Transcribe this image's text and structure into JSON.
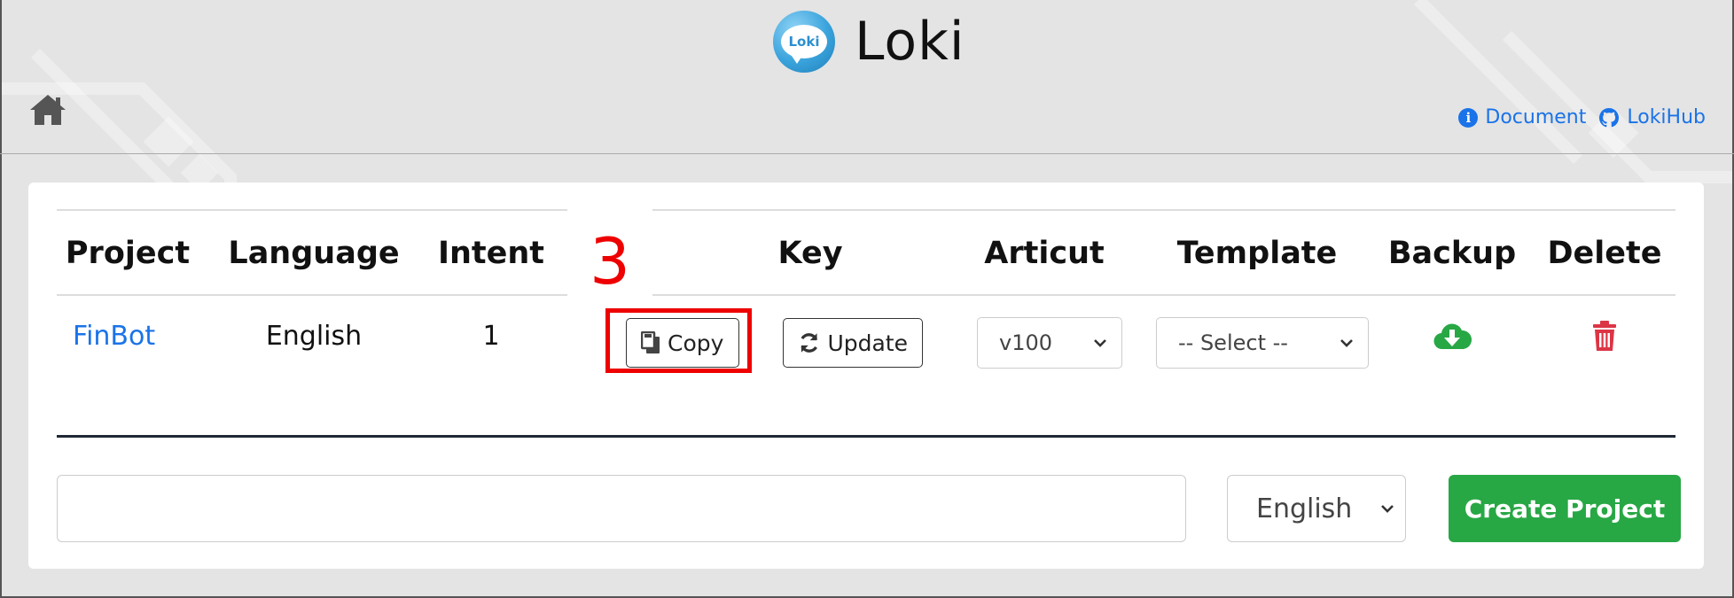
{
  "app": {
    "title": "Loki",
    "logo_text": "Loki"
  },
  "header": {
    "links": [
      {
        "label": "Document",
        "icon": "info-icon"
      },
      {
        "label": "LokiHub",
        "icon": "github-icon"
      }
    ]
  },
  "table": {
    "columns": [
      "Project",
      "Language",
      "Intent",
      "Key",
      "Articut",
      "Template",
      "Backup",
      "Delete"
    ],
    "rows": [
      {
        "project": "FinBot",
        "language": "English",
        "intent": "1",
        "copy_label": "Copy",
        "update_label": "Update",
        "articut": "v100",
        "template": "-- Select --"
      }
    ]
  },
  "annotation": {
    "number": "3",
    "color": "#ee0000"
  },
  "create": {
    "name_value": "",
    "language": "English",
    "button_label": "Create Project"
  },
  "colors": {
    "link": "#1a73e8",
    "backup": "#28a745",
    "delete": "#dc3545",
    "create": "#28a745"
  }
}
